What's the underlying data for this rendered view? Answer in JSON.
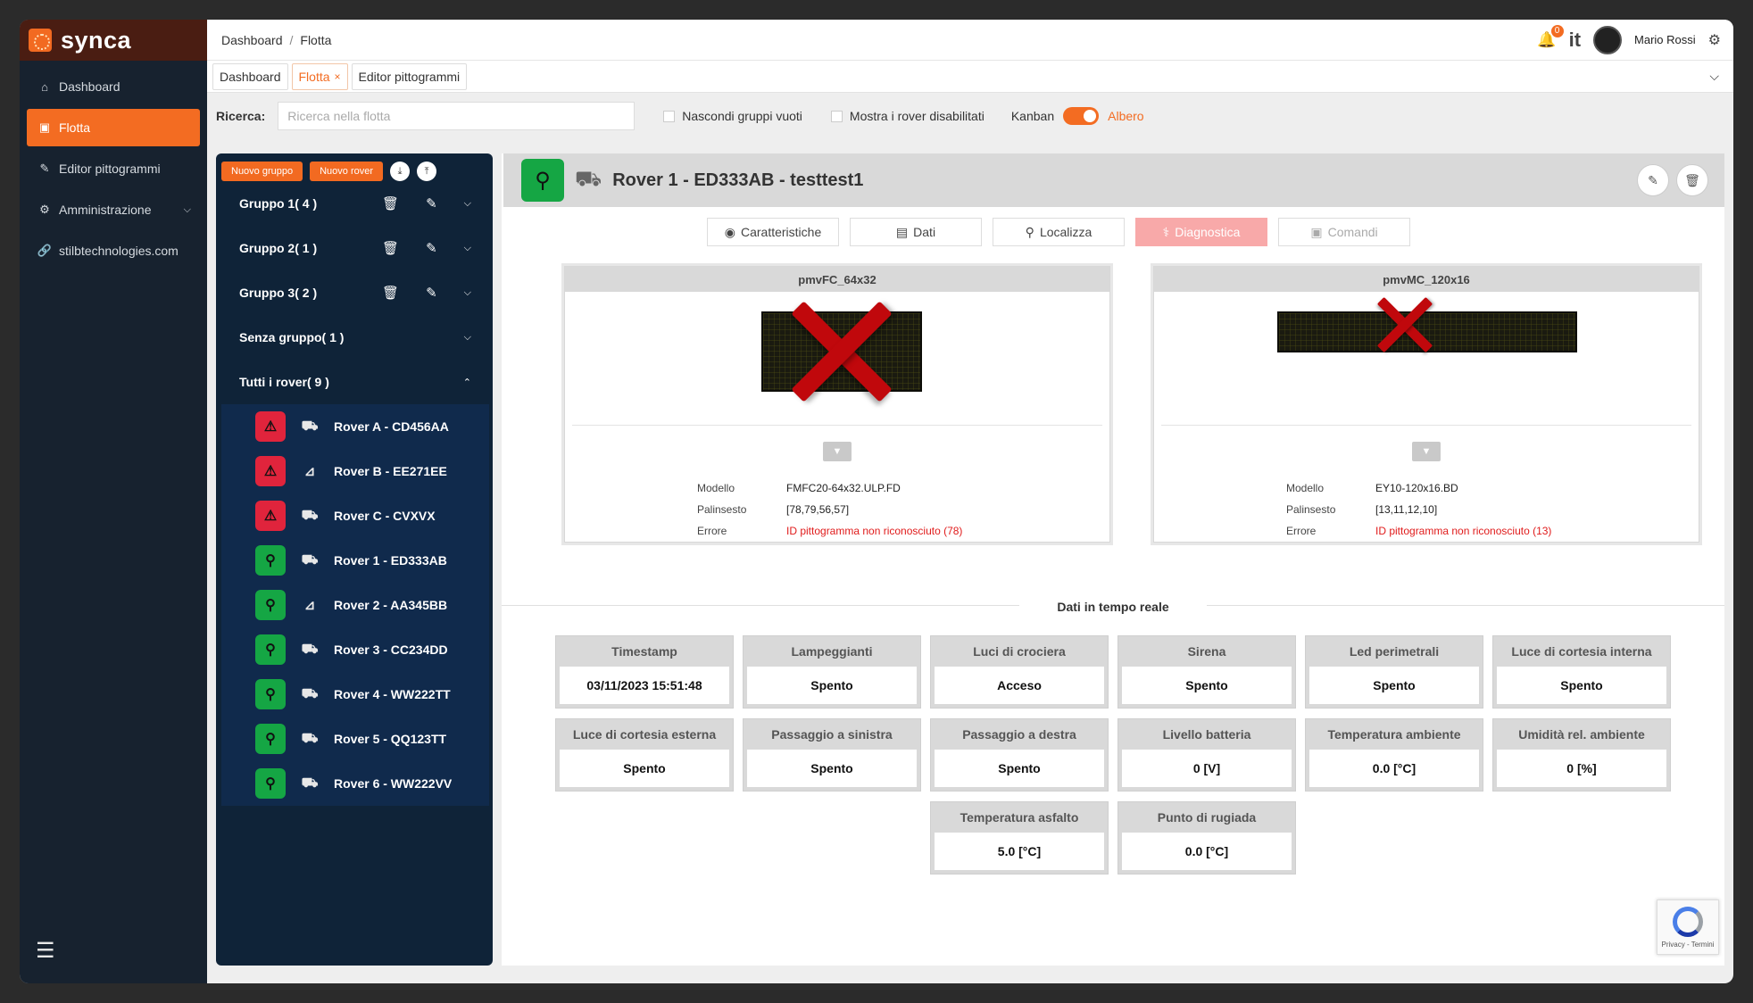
{
  "brand": {
    "name": "synca"
  },
  "sidebar": {
    "items": [
      {
        "label": "Dashboard",
        "icon": "home-icon",
        "active": false
      },
      {
        "label": "Flotta",
        "icon": "bus-icon",
        "active": true
      },
      {
        "label": "Editor pittogrammi",
        "icon": "pencil-icon",
        "active": false
      },
      {
        "label": "Amministrazione",
        "icon": "gear-icon",
        "active": false,
        "expandable": true
      },
      {
        "label": "stilbtechnologies.com",
        "icon": "link-icon",
        "active": false
      }
    ],
    "collapse_icon": "collapse-menu-icon"
  },
  "topbar": {
    "breadcrumb": [
      "Dashboard",
      "Flotta"
    ],
    "notifications": "0",
    "language": "it",
    "user_name": "Mario Rossi"
  },
  "tabs": [
    {
      "label": "Dashboard",
      "active": false
    },
    {
      "label": "Flotta",
      "active": true,
      "closable": true
    },
    {
      "label": "Editor pittogrammi",
      "active": false
    }
  ],
  "toolbar": {
    "search_label": "Ricerca:",
    "search_placeholder": "Ricerca nella flotta",
    "hide_empty_label": "Nascondi gruppi vuoti",
    "show_disabled_label": "Mostra i rover disabilitati",
    "view_off_label": "Kanban",
    "view_on_label": "Albero"
  },
  "fleet": {
    "new_group_label": "Nuovo gruppo",
    "new_rover_label": "Nuovo rover",
    "groups": [
      {
        "label": "Gruppo 1( 4 )",
        "editable": true
      },
      {
        "label": "Gruppo 2( 1 )",
        "editable": true
      },
      {
        "label": "Gruppo 3( 2 )",
        "editable": true
      },
      {
        "label": "Senza gruppo( 1 )",
        "editable": false
      },
      {
        "label": "Tutti i rover( 9 )",
        "editable": false,
        "expanded": true
      }
    ],
    "rovers": [
      {
        "label": "Rover A - CD456AA",
        "status": "error",
        "vehicle": "pickup"
      },
      {
        "label": "Rover B - EE271EE",
        "status": "error",
        "vehicle": "trailer"
      },
      {
        "label": "Rover C - CVXVX",
        "status": "error",
        "vehicle": "pickup"
      },
      {
        "label": "Rover 1 - ED333AB",
        "status": "ok",
        "vehicle": "pickup"
      },
      {
        "label": "Rover 2 - AA345BB",
        "status": "ok",
        "vehicle": "trailer"
      },
      {
        "label": "Rover 3 - CC234DD",
        "status": "ok",
        "vehicle": "truck"
      },
      {
        "label": "Rover 4 - WW222TT",
        "status": "ok",
        "vehicle": "van"
      },
      {
        "label": "Rover 5 - QQ123TT",
        "status": "ok",
        "vehicle": "pickup"
      },
      {
        "label": "Rover 6 - WW222VV",
        "status": "ok",
        "vehicle": "car"
      }
    ]
  },
  "detail": {
    "title": "Rover 1 - ED333AB - testtest1",
    "tabs": [
      {
        "label": "Caratteristiche",
        "state": "normal"
      },
      {
        "label": "Dati",
        "state": "normal"
      },
      {
        "label": "Localizza",
        "state": "normal"
      },
      {
        "label": "Diagnostica",
        "state": "active"
      },
      {
        "label": "Comandi",
        "state": "disabled"
      }
    ],
    "pictograms": [
      {
        "name": "pmvFC_64x32",
        "model_label": "Modello",
        "model": "FMFC20-64x32.ULP.FD",
        "schedule_label": "Palinsesto",
        "schedule": "[78,79,56,57]",
        "error_label": "Errore",
        "error": "ID pittogramma non riconosciuto (78)"
      },
      {
        "name": "pmvMC_120x16",
        "model_label": "Modello",
        "model": "EY10-120x16.BD",
        "schedule_label": "Palinsesto",
        "schedule": "[13,11,12,10]",
        "error_label": "Errore",
        "error": "ID pittogramma non riconosciuto (13)"
      }
    ],
    "realtime_title": "Dati in tempo reale",
    "realtime": [
      {
        "label": "Timestamp",
        "value": "03/11/2023 15:51:48"
      },
      {
        "label": "Lampeggianti",
        "value": "Spento"
      },
      {
        "label": "Luci di crociera",
        "value": "Acceso"
      },
      {
        "label": "Sirena",
        "value": "Spento"
      },
      {
        "label": "Led perimetrali",
        "value": "Spento"
      },
      {
        "label": "Luce di cortesia interna",
        "value": "Spento"
      },
      {
        "label": "Luce di cortesia esterna",
        "value": "Spento"
      },
      {
        "label": "Passaggio a sinistra",
        "value": "Spento"
      },
      {
        "label": "Passaggio a destra",
        "value": "Spento"
      },
      {
        "label": "Livello batteria",
        "value": "0 [V]"
      },
      {
        "label": "Temperatura ambiente",
        "value": "0.0 [°C]"
      },
      {
        "label": "Umidità rel. ambiente",
        "value": "0 [%]"
      },
      {
        "label": "Temperatura asfalto",
        "value": "5.0 [°C]"
      },
      {
        "label": "Punto di rugiada",
        "value": "0.0 [°C]"
      }
    ]
  },
  "recaptcha": {
    "text": "Privacy - Termini"
  },
  "colors": {
    "accent": "#f36c22",
    "ok": "#15a644",
    "error": "#e0243c",
    "sidebar": "#17222f"
  }
}
